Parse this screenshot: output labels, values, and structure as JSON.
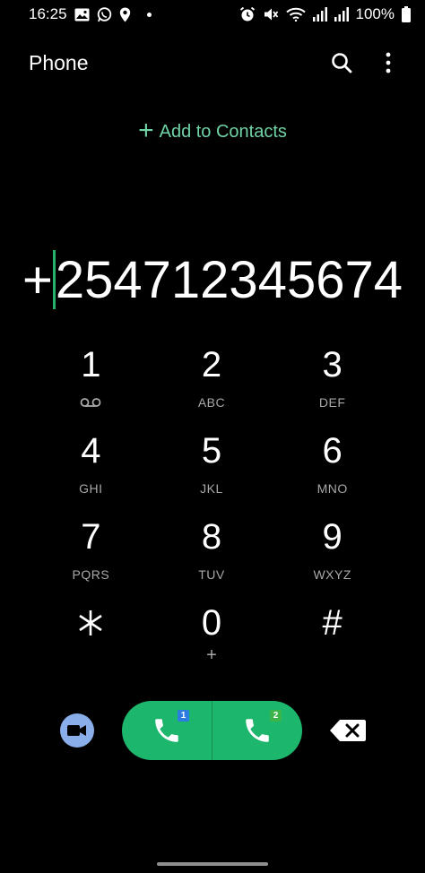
{
  "status_bar": {
    "time": "16:25",
    "battery": "100%",
    "icons_left": [
      "gallery-icon",
      "whatsapp-icon",
      "location-icon",
      "dot-icon"
    ],
    "icons_right": [
      "alarm-icon",
      "mute-icon",
      "wifi-icon",
      "signal-icon",
      "signal-icon",
      "battery-icon"
    ]
  },
  "app_bar": {
    "title": "Phone",
    "search_icon": "search-icon",
    "more_icon": "more-vert-icon"
  },
  "add_contacts": {
    "plus": "+",
    "label": "Add to Contacts"
  },
  "number_display": {
    "before_caret": "+",
    "after_caret": "254712345674"
  },
  "keypad": {
    "keys": [
      {
        "digit": "1",
        "letters": "",
        "sub_icon": "voicemail-icon"
      },
      {
        "digit": "2",
        "letters": "ABC"
      },
      {
        "digit": "3",
        "letters": "DEF"
      },
      {
        "digit": "4",
        "letters": "GHI"
      },
      {
        "digit": "5",
        "letters": "JKL"
      },
      {
        "digit": "6",
        "letters": "MNO"
      },
      {
        "digit": "7",
        "letters": "PQRS"
      },
      {
        "digit": "8",
        "letters": "TUV"
      },
      {
        "digit": "9",
        "letters": "WXYZ"
      },
      {
        "digit": "*",
        "letters": ""
      },
      {
        "digit": "0",
        "letters": "+"
      },
      {
        "digit": "#",
        "letters": ""
      }
    ]
  },
  "bottom_actions": {
    "video_icon": "video-call-icon",
    "call_sim1_badge": "1",
    "call_sim2_badge": "2",
    "backspace_icon": "backspace-icon"
  },
  "colors": {
    "background": "#000000",
    "accent_green": "#1db66d",
    "add_contacts_green": "#6fd3a6",
    "caret_green": "#27b36b",
    "video_button": "#8aaeea",
    "sim1_badge": "#2d7de0",
    "sim2_badge": "#3bb54a"
  }
}
